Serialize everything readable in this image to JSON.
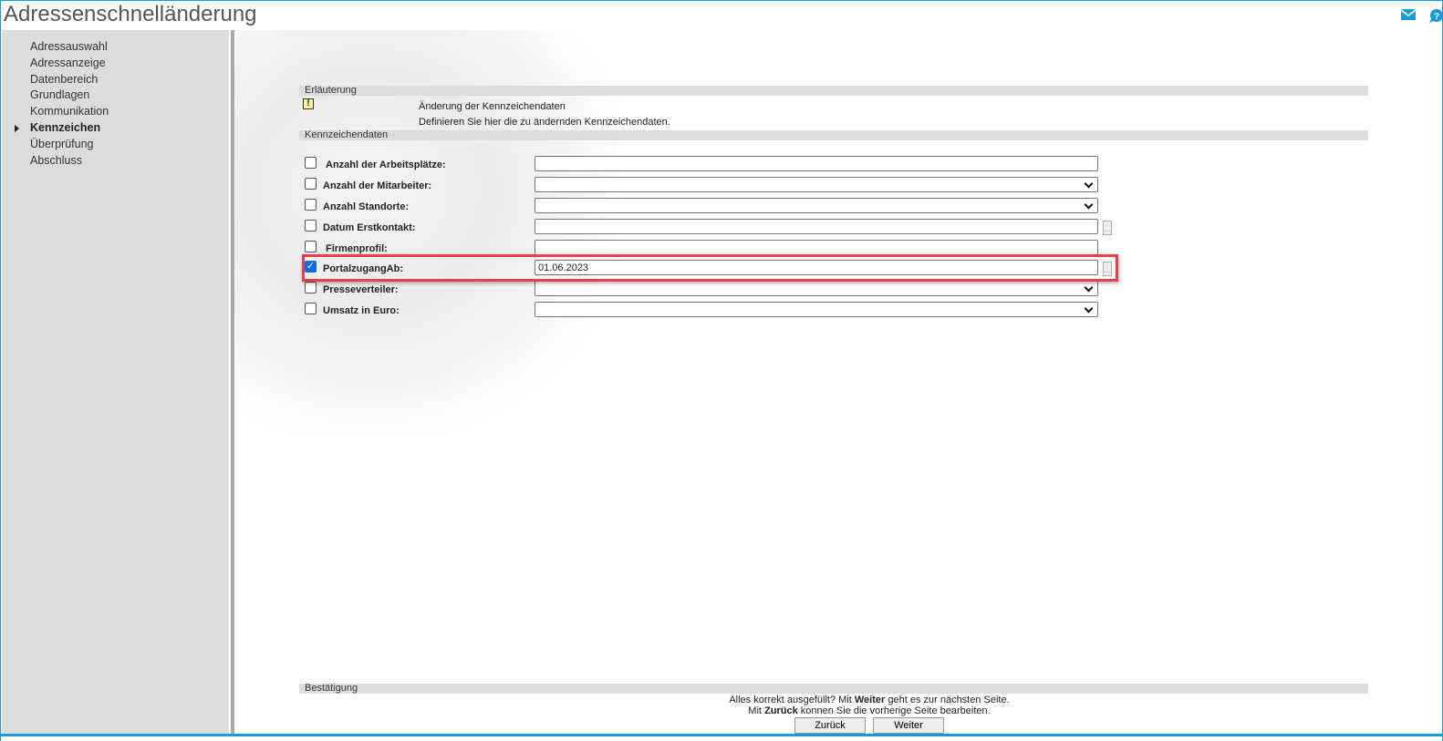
{
  "title": "Adressenschnelländerung",
  "icons": {
    "mail": "mail-icon",
    "help": "help-icon"
  },
  "sidebar": {
    "items": [
      {
        "label": "Adressauswahl"
      },
      {
        "label": "Adressanzeige"
      },
      {
        "label": "Datenbereich"
      },
      {
        "label": "Grundlagen"
      },
      {
        "label": "Kommunikation"
      },
      {
        "label": "Kennzeichen",
        "active": true
      },
      {
        "label": "Überprüfung"
      },
      {
        "label": "Abschluss"
      }
    ]
  },
  "explanation": {
    "header": "Erläuterung",
    "title": "Änderung der Kennzeichendaten",
    "text": "Definieren Sie hier die zu ändernden Kennzeichendaten."
  },
  "form": {
    "header": "Kennzeichendaten",
    "rows": [
      {
        "label": "Anzahl der Arbeitsplätze:",
        "type": "text",
        "value": "",
        "checked": false
      },
      {
        "label": "Anzahl der Mitarbeiter:",
        "type": "select",
        "value": "",
        "checked": false
      },
      {
        "label": "Anzahl Standorte:",
        "type": "select",
        "value": "",
        "checked": false
      },
      {
        "label": "Datum Erstkontakt:",
        "type": "date",
        "value": "",
        "checked": false
      },
      {
        "label": "Firmenprofil:",
        "type": "text",
        "value": "",
        "checked": false
      },
      {
        "label": "PortalzugangAb:",
        "type": "date",
        "value": "01.06.2023",
        "checked": true
      },
      {
        "label": "Presseverteiler:",
        "type": "select",
        "value": "",
        "checked": false
      },
      {
        "label": "Umsatz in Euro:",
        "type": "select",
        "value": "",
        "checked": false
      }
    ]
  },
  "confirm": {
    "header": "Bestätigung",
    "line1_a": "Alles korrekt ausgefüllt?  Mit ",
    "line1_b": "Weiter",
    "line1_c": " geht es zur nächsten Seite.",
    "line2_a": "Mit ",
    "line2_b": "Zurück",
    "line2_c": " konnen Sie die vorherige Seite bearbeiten.",
    "back": "Zurück",
    "next": "Weiter",
    "dots": "..."
  },
  "colors": {
    "accent": "#1a9ad6",
    "highlight": "#e8404a"
  }
}
